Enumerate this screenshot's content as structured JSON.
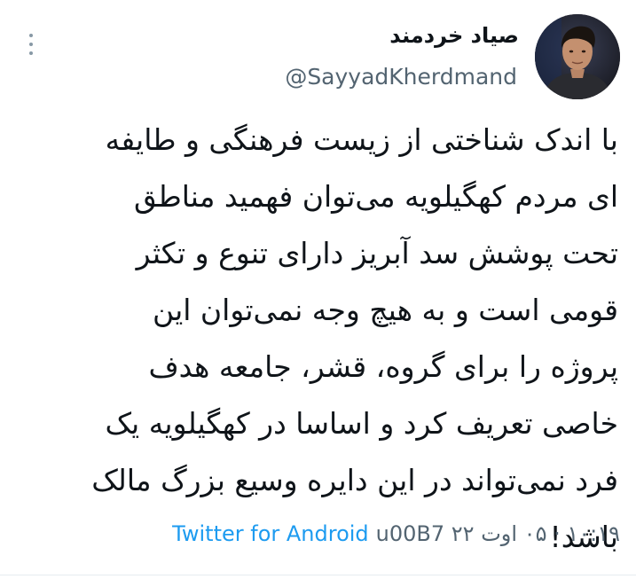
{
  "tweet": {
    "display_name": "صیاد خردمند",
    "handle": "@SayyadKherdmand",
    "more_icon": "more-vertical-icon",
    "avatar_icon": "avatar-photo",
    "text_lines": [
      "با اندک شناختی از زیست فرهنگی و طایفه",
      "ای مردم کهگیلویه می‌توان فهمید  مناطق",
      "تحت پوشش سد آبریز  دارای تنوع و تکثر",
      "قومی است و به هیچ وجه نمی‌توان این",
      "پروژه را برای گروه، قشر، جامعه هدف",
      "خاصی تعریف کرد و اساسا در کهگیلویه یک",
      "فرد نمی‌تواند در این دایره وسیع بزرگ مالک",
      "باشد!"
    ],
    "timestamp": "۱۰:۱۹ · ۰۵ اوت ۲۲ u00B7",
    "source": "Twitter for Android",
    "colors": {
      "link": "#1d9bf0",
      "secondary": "#536471",
      "primary": "#0f1419"
    }
  }
}
